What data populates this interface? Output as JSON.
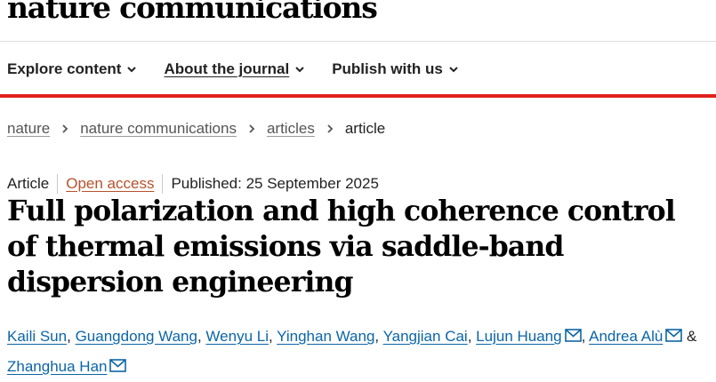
{
  "site": {
    "journal_title": "nature communications"
  },
  "nav": {
    "items": [
      {
        "label": "Explore content"
      },
      {
        "label": "About the journal"
      },
      {
        "label": "Publish with us"
      }
    ]
  },
  "breadcrumb": [
    "nature",
    "nature communications",
    "articles",
    "article"
  ],
  "article": {
    "type": "Article",
    "access": "Open access",
    "published": "Published: 25 September 2025",
    "title": "Full polarization and high coherence control of thermal emissions via saddle-band dispersion engineering"
  },
  "authors": {
    "names": [
      "Kaili Sun",
      "Guangdong Wang",
      "Wenyu Li",
      "Yinghan Wang",
      "Yangjian Cai",
      "Lujun Huang",
      "Andrea Alù",
      "Zhanghua Han"
    ],
    "separator": ",",
    "conjunction": "&"
  },
  "colors": {
    "accent_red": "#e0201c",
    "author_link": "#0b65a7",
    "open_access": "#b8512b"
  }
}
